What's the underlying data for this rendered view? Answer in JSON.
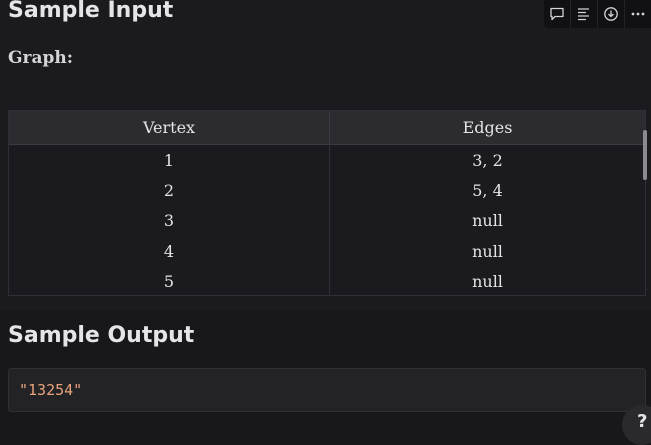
{
  "sample_input": {
    "title": "Sample Input",
    "graph_label": "Graph:",
    "table": {
      "headers": [
        "Vertex",
        "Edges"
      ],
      "rows": [
        [
          "1",
          "3, 2"
        ],
        [
          "2",
          "5, 4"
        ],
        [
          "3",
          "null"
        ],
        [
          "4",
          "null"
        ],
        [
          "5",
          "null"
        ]
      ]
    }
  },
  "toolbar": {
    "icons": [
      "comment-icon",
      "align-left-icon",
      "download-icon",
      "more-icon"
    ]
  },
  "sample_output": {
    "title": "Sample Output",
    "value": "\"13254\""
  },
  "help": {
    "label": "?"
  }
}
